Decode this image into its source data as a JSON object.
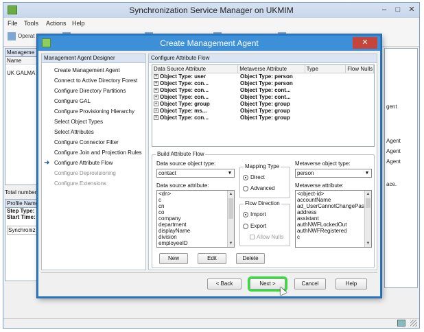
{
  "window": {
    "title": "Synchronization Service Manager on UKMIM",
    "controls": [
      "–",
      "□",
      "✕"
    ]
  },
  "menubar": [
    "File",
    "Tools",
    "Actions",
    "Help"
  ],
  "toolbar": [
    {
      "label": "Operat",
      "icon": "operations-icon"
    },
    {
      "label": "",
      "icon": "management-agents-icon"
    },
    {
      "label": "",
      "icon": "metaverse-designer-icon"
    },
    {
      "label": "",
      "icon": "metaverse-search-icon"
    },
    {
      "label": "",
      "icon": "joiner-icon"
    }
  ],
  "bg_left_pane": {
    "header": "Manageme",
    "col_header": "Name",
    "rows": [
      "UK GALMA"
    ]
  },
  "bg_total": "Total number",
  "bg_profile": {
    "header": "Profile Name",
    "step_type": "Step Type:",
    "start_time": "Start Time:",
    "sub": "Synchroniz"
  },
  "bg_right_texts": [
    "gent",
    "Agent",
    "Agent",
    "Agent",
    "ace."
  ],
  "dialog": {
    "title": "Create Management Agent",
    "close": "✕",
    "designer_header": "Management Agent Designer",
    "nav": [
      {
        "label": "Create Management Agent",
        "state": "done"
      },
      {
        "label": "Connect to Active Directory Forest",
        "state": "done"
      },
      {
        "label": "Configure Directory Partitions",
        "state": "done"
      },
      {
        "label": "Configure GAL",
        "state": "done"
      },
      {
        "label": "Configure Provisioning Hierarchy",
        "state": "done"
      },
      {
        "label": "Select Object Types",
        "state": "done"
      },
      {
        "label": "Select Attributes",
        "state": "done"
      },
      {
        "label": "Configure Connector Filter",
        "state": "done"
      },
      {
        "label": "Configure Join and Projection Rules",
        "state": "done"
      },
      {
        "label": "Configure Attribute Flow",
        "state": "current"
      },
      {
        "label": "Configure Deprovisioning",
        "state": "disabled"
      },
      {
        "label": "Configure Extensions",
        "state": "disabled"
      }
    ],
    "content_header": "Configure Attribute Flow",
    "grid": {
      "columns": [
        "Data Source Attribute",
        "Metaverse Attribute",
        "Type",
        "Flow Nulls"
      ],
      "rows": [
        {
          "source": "Object Type: user",
          "metaverse": "Object Type: person"
        },
        {
          "source": "Object Type: con...",
          "metaverse": "Object Type: person"
        },
        {
          "source": "Object Type: con...",
          "metaverse": "Object Type: cont..."
        },
        {
          "source": "Object Type: con...",
          "metaverse": "Object Type: cont..."
        },
        {
          "source": "Object Type: group",
          "metaverse": "Object Type: group"
        },
        {
          "source": "Object Type: ms...",
          "metaverse": "Object Type: group"
        },
        {
          "source": "Object Type: con...",
          "metaverse": "Object Type: group"
        }
      ]
    },
    "build": {
      "legend": "Build Attribute Flow",
      "ds_object_type_label": "Data source object type:",
      "ds_object_type_value": "contact",
      "ds_attribute_label": "Data source attribute:",
      "ds_attributes": [
        "<dn>",
        "c",
        "cn",
        "co",
        "company",
        "department",
        "displayName",
        "division",
        "employeeID"
      ],
      "mapping_type_legend": "Mapping Type",
      "mapping_direct": "Direct",
      "mapping_advanced": "Advanced",
      "flow_direction_legend": "Flow Direction",
      "flow_import": "Import",
      "flow_export": "Export",
      "allow_nulls": "Allow Nulls",
      "mv_object_type_label": "Metaverse object type:",
      "mv_object_type_value": "person",
      "mv_attribute_label": "Metaverse attribute:",
      "mv_attributes": [
        "<object-id>",
        "accountName",
        "ad_UserCannotChangePass",
        "address",
        "assistant",
        "authNWFLockedOut",
        "authNWFRegistered",
        "c"
      ],
      "new_button": "New",
      "edit_button": "Edit",
      "delete_button": "Delete"
    },
    "buttons": {
      "back": "< Back",
      "next": "Next >",
      "cancel": "Cancel",
      "help": "Help"
    }
  }
}
